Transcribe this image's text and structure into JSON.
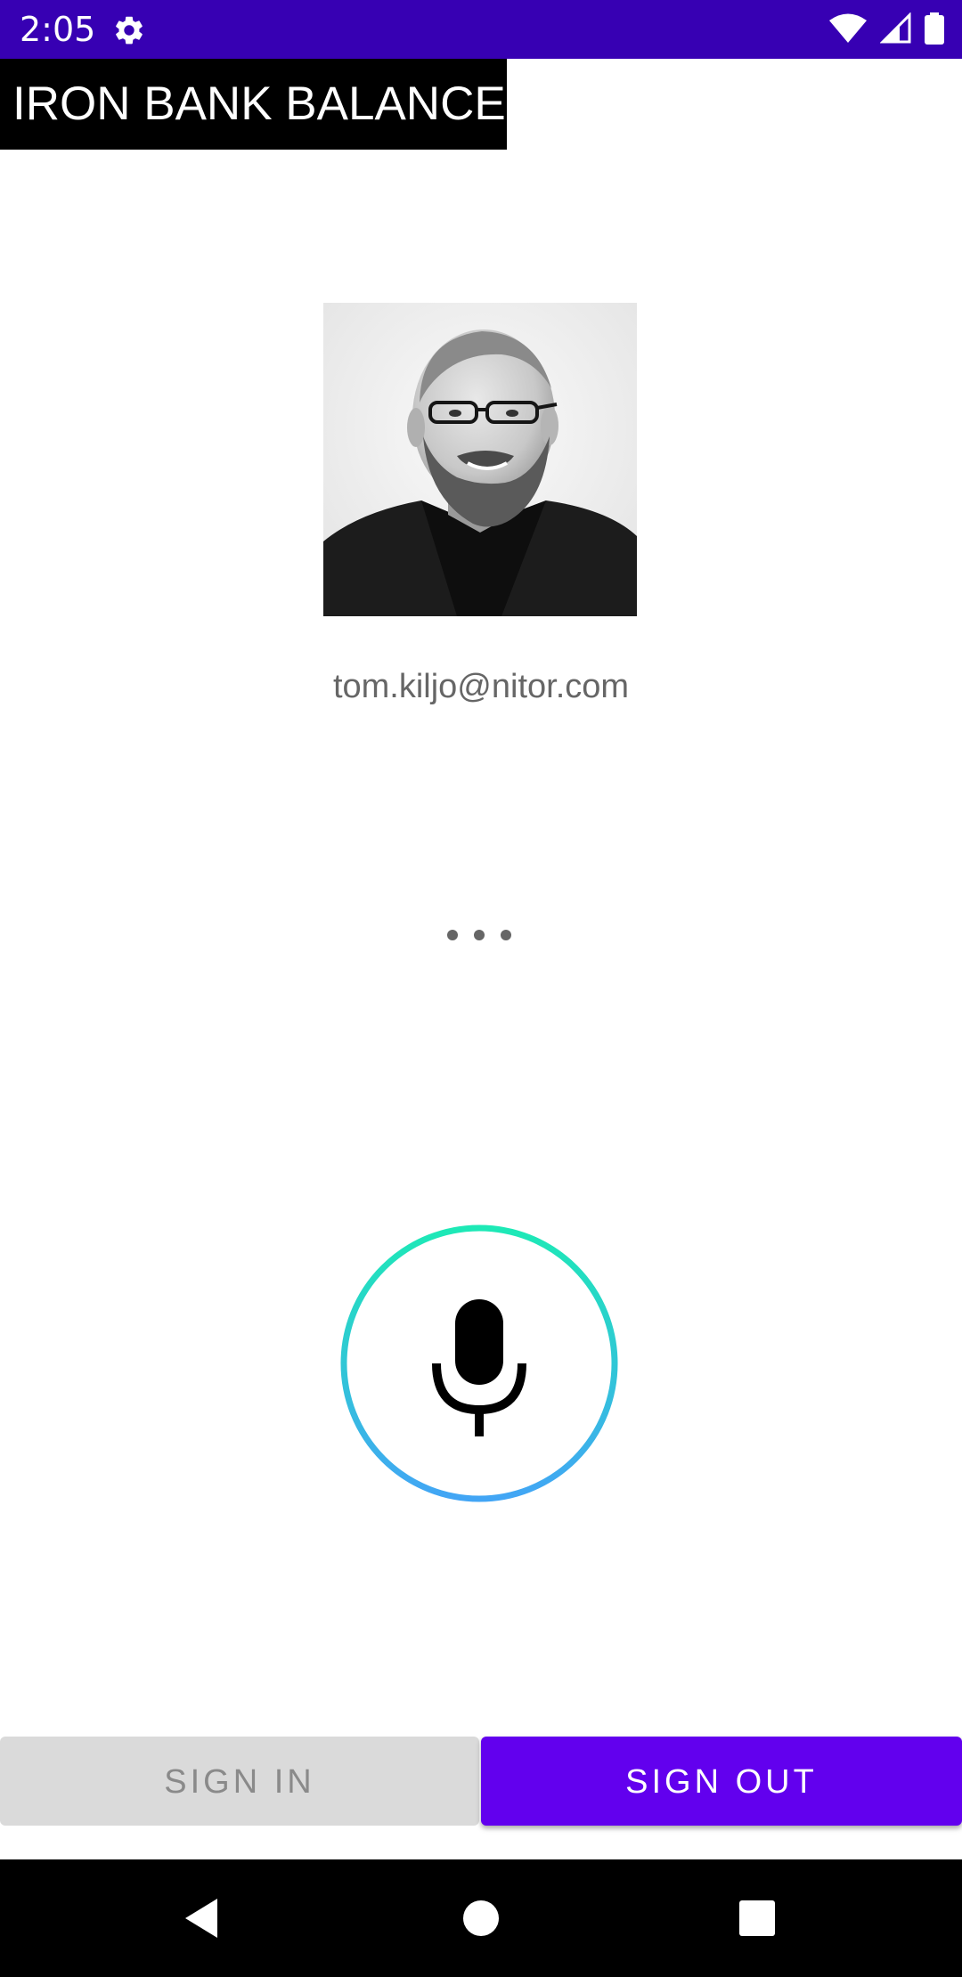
{
  "status_bar": {
    "time": "2:05",
    "icons": [
      "gear-icon",
      "wifi-icon",
      "signal-icon",
      "battery-icon"
    ],
    "background": "#3700b3"
  },
  "app": {
    "title": "IRON BANK BALANCE"
  },
  "profile": {
    "email": "tom.kiljo@nitor.com",
    "avatar_icon": "profile-photo"
  },
  "status_indicator": {
    "icon": "more-horiz-icon"
  },
  "voice": {
    "icon": "microphone-icon",
    "ring_colors": [
      "#1de9b6",
      "#42a5f5"
    ]
  },
  "buttons": {
    "sign_in_label": "SIGN IN",
    "sign_out_label": "SIGN OUT",
    "primary_color": "#6200ee"
  },
  "nav_bar": {
    "icons": [
      "back-icon",
      "home-icon",
      "recents-icon"
    ]
  }
}
